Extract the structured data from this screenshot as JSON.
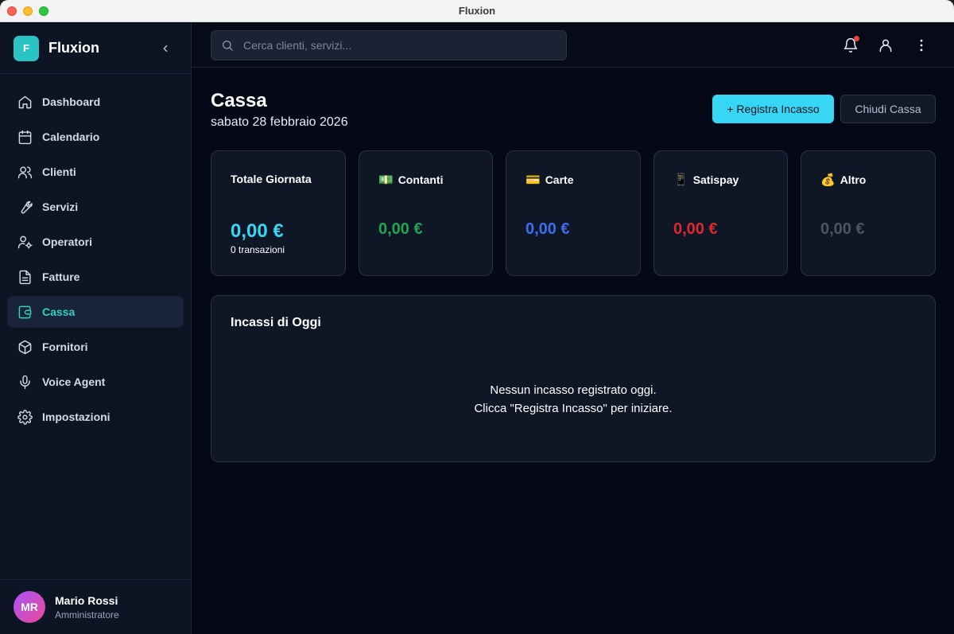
{
  "window": {
    "title": "Fluxion"
  },
  "sidebar": {
    "brand_logo": "F",
    "brand_name": "Fluxion",
    "items": [
      {
        "label": "Dashboard",
        "icon": "home-icon"
      },
      {
        "label": "Calendario",
        "icon": "calendar-icon"
      },
      {
        "label": "Clienti",
        "icon": "users-icon"
      },
      {
        "label": "Servizi",
        "icon": "wrench-icon"
      },
      {
        "label": "Operatori",
        "icon": "user-cog-icon"
      },
      {
        "label": "Fatture",
        "icon": "file-text-icon"
      },
      {
        "label": "Cassa",
        "icon": "wallet-icon",
        "active": true
      },
      {
        "label": "Fornitori",
        "icon": "package-icon"
      },
      {
        "label": "Voice Agent",
        "icon": "microphone-icon"
      },
      {
        "label": "Impostazioni",
        "icon": "gear-icon"
      }
    ],
    "user": {
      "initials": "MR",
      "name": "Mario Rossi",
      "role": "Amministratore"
    }
  },
  "header": {
    "search_placeholder": "Cerca clienti, servizi..."
  },
  "page": {
    "title": "Cassa",
    "date": "sabato 28 febbraio 2026",
    "register_button": "+ Registra Incasso",
    "close_button": "Chiudi Cassa"
  },
  "cards": [
    {
      "label": "Totale Giornata",
      "emoji": "",
      "value": "0,00 €",
      "sub": "0 transazioni",
      "color": "#38d6f5"
    },
    {
      "label": "Contanti",
      "emoji": "💵",
      "value": "0,00 €",
      "color": "#22a352"
    },
    {
      "label": "Carte",
      "emoji": "💳",
      "value": "0,00 €",
      "color": "#3b6ff0"
    },
    {
      "label": "Satispay",
      "emoji": "📱",
      "value": "0,00 €",
      "color": "#e0282e"
    },
    {
      "label": "Altro",
      "emoji": "💰",
      "value": "0,00 €",
      "color": "#4b5563"
    }
  ],
  "panel": {
    "title": "Incassi di Oggi",
    "empty_line1": "Nessun incasso registrato oggi.",
    "empty_line2": "Clicca \"Registra Incasso\" per iniziare."
  },
  "colors": {
    "accent": "#2dd4bf",
    "primary_button": "#38d6f5",
    "notification": "#ef4444"
  }
}
